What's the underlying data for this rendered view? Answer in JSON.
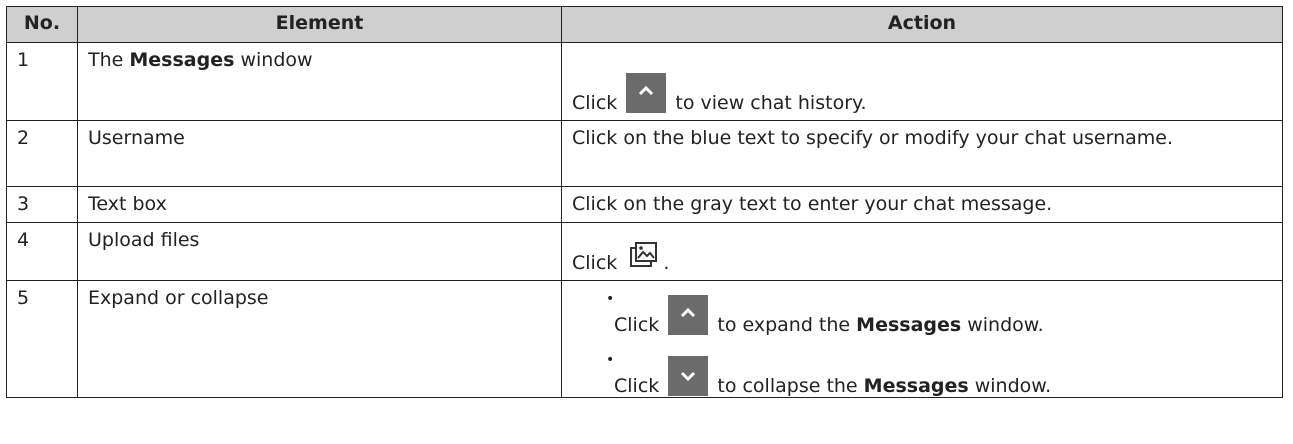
{
  "header": {
    "no": "No.",
    "element": "Element",
    "action": "Action"
  },
  "rows": [
    {
      "no": "1",
      "element_pre": "The ",
      "element_bold": "Messages",
      "element_post": " window",
      "action_pre": "Click ",
      "action_icon": "chevron-up-icon",
      "action_post": " to view chat history."
    },
    {
      "no": "2",
      "element": "Username",
      "action": "Click on the blue text to specify or modify your chat username."
    },
    {
      "no": "3",
      "element": "Text box",
      "action": "Click on the gray text to enter your chat message."
    },
    {
      "no": "4",
      "element": "Upload files",
      "action_pre": "Click ",
      "action_icon": "upload-image-icon",
      "action_post": "."
    },
    {
      "no": "5",
      "element": "Expand or collapse",
      "bullets": [
        {
          "pre": "Click ",
          "icon": "chevron-up-icon",
          "mid": " to expand the ",
          "bold": "Messages",
          "post": " window."
        },
        {
          "pre": "Click ",
          "icon": "chevron-down-icon",
          "mid": " to collapse the ",
          "bold": "Messages",
          "post": " window."
        }
      ]
    }
  ],
  "colors": {
    "header_bg": "#cfcfcf",
    "icon_bg": "#6b6b6b"
  }
}
